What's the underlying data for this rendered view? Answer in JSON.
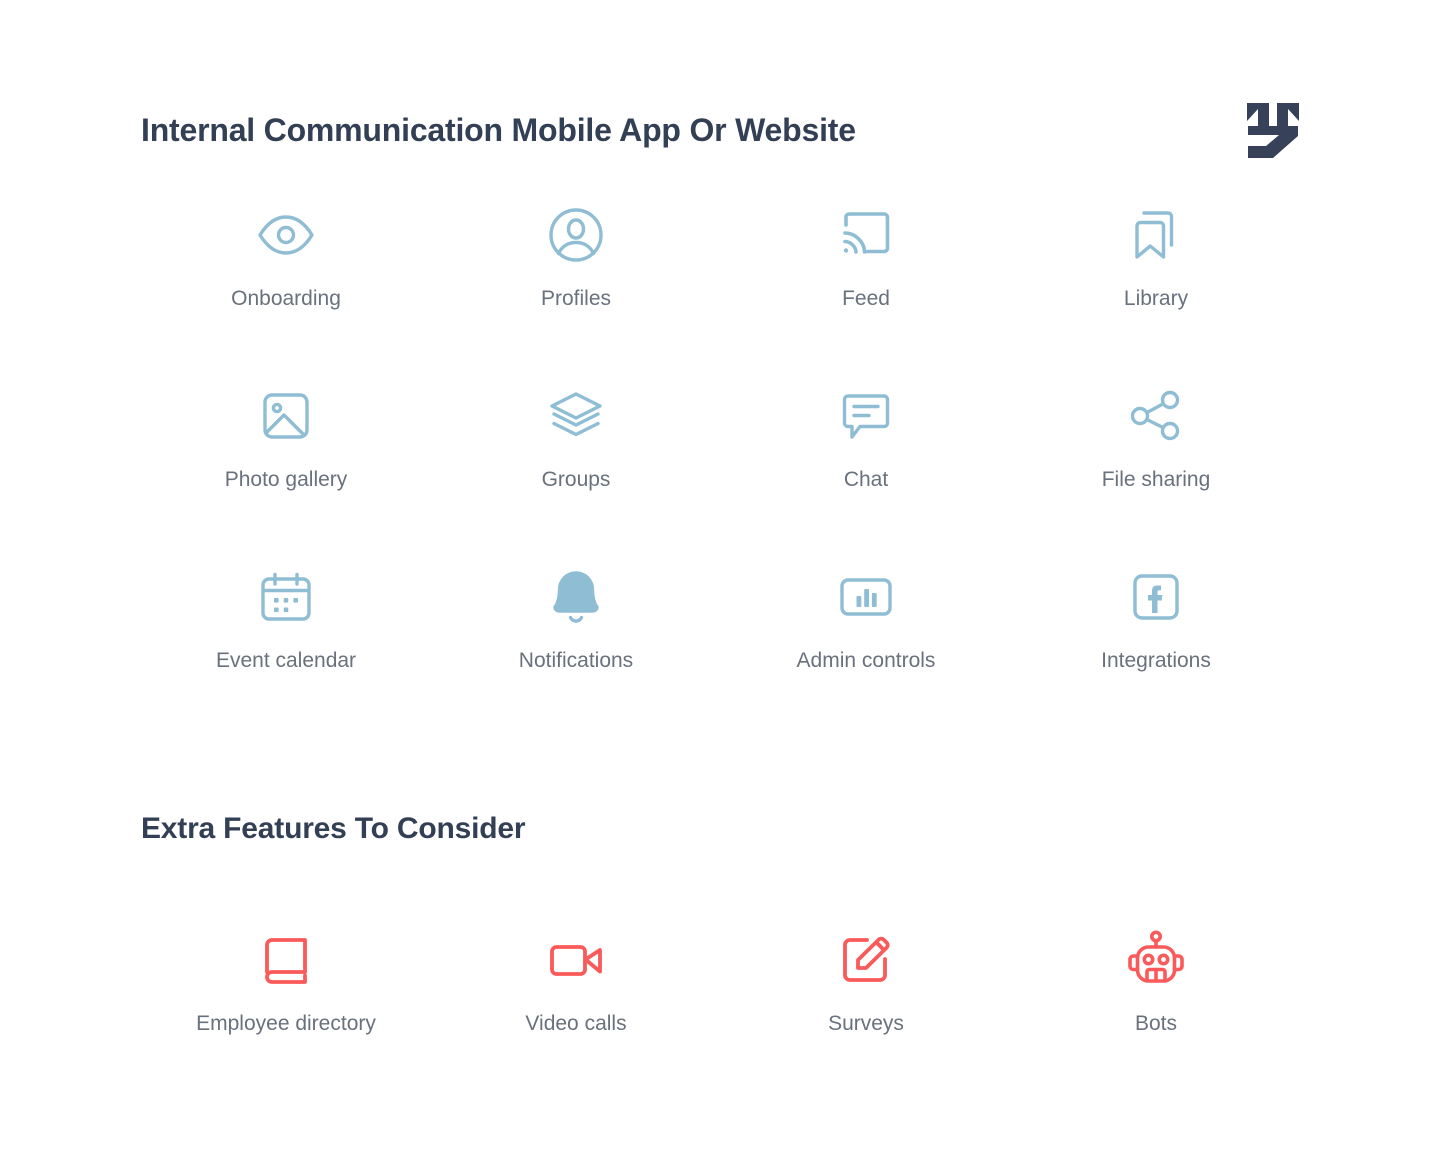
{
  "header": {
    "title": "Internal Communication Mobile App Or Website",
    "logo_name": "ms-monogram-logo"
  },
  "colors": {
    "title_text": "#323f54",
    "label_text": "#69717d",
    "primary_icon": "#8fbdd3",
    "extra_icon": "#fa5a5a",
    "background": "#ffffff",
    "logo": "#37425a"
  },
  "sections": [
    {
      "id": "core-features",
      "heading": null,
      "icon_color": "#8fbdd3",
      "items": [
        {
          "label": "Onboarding",
          "icon": "eye-icon"
        },
        {
          "label": "Profiles",
          "icon": "user-circle-icon"
        },
        {
          "label": "Feed",
          "icon": "cast-screen-icon"
        },
        {
          "label": "Library",
          "icon": "bookmarks-icon"
        },
        {
          "label": "Photo gallery",
          "icon": "image-icon"
        },
        {
          "label": "Groups",
          "icon": "layers-icon"
        },
        {
          "label": "Chat",
          "icon": "speech-bubble-icon"
        },
        {
          "label": "File sharing",
          "icon": "share-nodes-icon"
        },
        {
          "label": "Event calendar",
          "icon": "calendar-icon"
        },
        {
          "label": "Notifications",
          "icon": "bell-icon"
        },
        {
          "label": "Admin controls",
          "icon": "bar-chart-icon"
        },
        {
          "label": "Integrations",
          "icon": "facebook-square-icon"
        }
      ]
    },
    {
      "id": "extra-features",
      "heading": "Extra Features To Consider",
      "icon_color": "#fa5a5a",
      "items": [
        {
          "label": "Employee directory",
          "icon": "book-icon"
        },
        {
          "label": "Video calls",
          "icon": "video-camera-icon"
        },
        {
          "label": "Surveys",
          "icon": "edit-square-icon"
        },
        {
          "label": "Bots",
          "icon": "robot-icon"
        }
      ]
    }
  ]
}
